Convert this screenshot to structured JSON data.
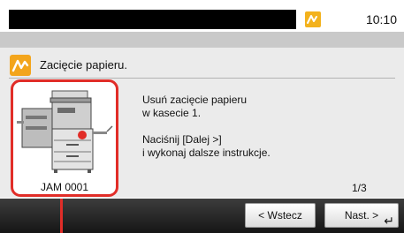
{
  "status_bar": {
    "time": "10:10",
    "alert_icon": "paper-jam-alert-icon",
    "alert_color": "#f3b21d"
  },
  "message": {
    "icon": "paper-jam-icon",
    "icon_color": "#f3a51c",
    "title": "Zacięcie papieru."
  },
  "device": {
    "jam_code": "JAM 0001",
    "highlight_color": "#e12d28"
  },
  "instructions": {
    "line1": "Usuń zacięcie papieru",
    "line2": "w kasecie 1.",
    "line3": "Naciśnij [Dalej >]",
    "line4": "i wykonaj dalsze instrukcje."
  },
  "pagination": {
    "page": "1/3"
  },
  "buttons": {
    "back_label": "< Wstecz",
    "next_label": "Nast. >",
    "next_icon": "enter-icon"
  }
}
